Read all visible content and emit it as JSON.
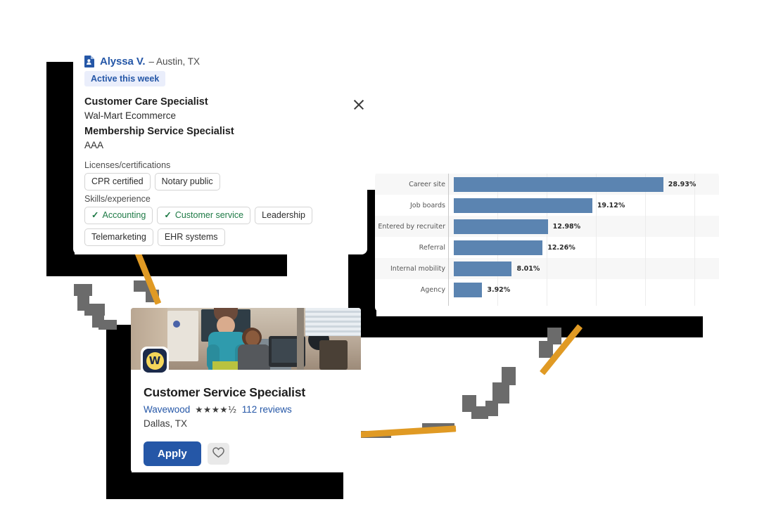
{
  "profile": {
    "doc_icon": "resume-document-icon",
    "name": "Alyssa V.",
    "location": "– Austin, TX",
    "close_icon": "close-icon",
    "badge": "Active this week",
    "experience": [
      {
        "title": "Customer Care Specialist",
        "employer": "Wal-Mart Ecommerce"
      },
      {
        "title": "Membership Service Specialist",
        "employer": "AAA"
      }
    ],
    "licenses_label": "Licenses/certifications",
    "licenses": [
      {
        "label": "CPR certified",
        "checked": false
      },
      {
        "label": "Notary public",
        "checked": false
      }
    ],
    "skills_label": "Skills/experience",
    "skills": [
      {
        "label": "Accounting",
        "checked": true
      },
      {
        "label": "Customer service",
        "checked": true
      },
      {
        "label": "Leadership",
        "checked": false
      },
      {
        "label": "Telemarketing",
        "checked": false
      },
      {
        "label": "EHR systems",
        "checked": false
      }
    ],
    "check_glyph": "✓"
  },
  "chart_data": {
    "type": "bar",
    "orientation": "horizontal",
    "title": "",
    "xlabel": "",
    "ylabel": "",
    "categories": [
      "Career site",
      "Job boards",
      "Entered by recruiter",
      "Referral",
      "Internal mobility",
      "Agency"
    ],
    "values": [
      28.93,
      19.12,
      12.98,
      12.26,
      8.01,
      3.92
    ],
    "value_labels": [
      "28.93%",
      "19.12%",
      "12.98%",
      "12.26%",
      "8.01%",
      "3.92%"
    ],
    "xlim": [
      0,
      34
    ],
    "grid": true,
    "legend": "none",
    "bar_color": "#5b84b1",
    "band_color": "#f7f7f7"
  },
  "job": {
    "photo_alt": "office-photo",
    "logo_letter": "W",
    "title": "Customer Service Specialist",
    "company": "Wavewood",
    "stars": "★★★★½",
    "rating": 4.5,
    "reviews": "112 reviews",
    "location": "Dallas, TX",
    "apply_label": "Apply",
    "save_icon": "heart-outline-icon"
  },
  "colors": {
    "brand_blue": "#2557A7",
    "badge_bg": "#eaeefb",
    "bar_blue": "#5b84b1",
    "accent_orange": "#e09a24",
    "check_green": "#1e7a46",
    "shadow_black": "#000000",
    "pixel_gray": "#6b6b6b"
  }
}
